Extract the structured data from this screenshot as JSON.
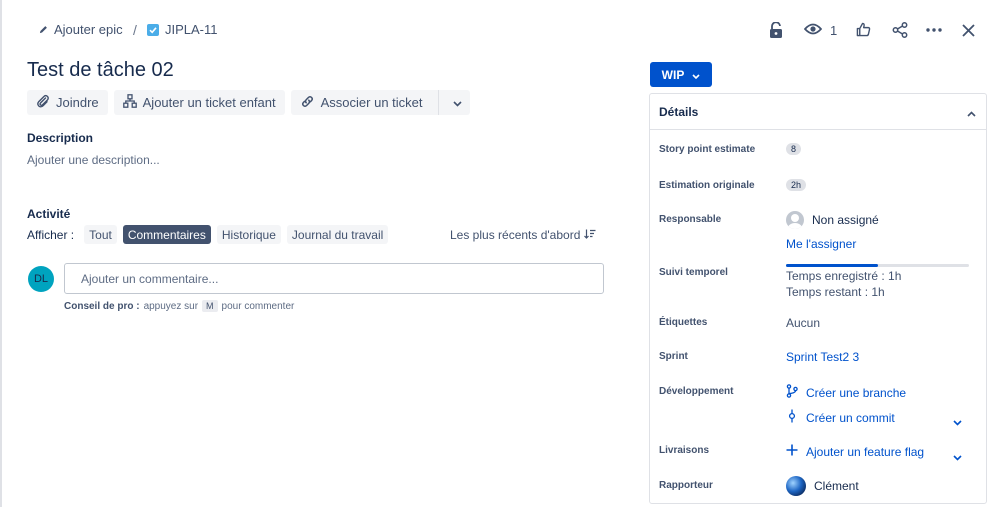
{
  "breadcrumb": {
    "epic_label": "Ajouter epic",
    "separator": "/",
    "issue_key": "JIPLA-11"
  },
  "header": {
    "watchers_count": "1"
  },
  "issue": {
    "title": "Test de tâche 02"
  },
  "actions": {
    "attach": "Joindre",
    "add_child": "Ajouter un ticket enfant",
    "link_issue": "Associer un ticket"
  },
  "description": {
    "label": "Description",
    "placeholder": "Ajouter une description..."
  },
  "activity": {
    "label": "Activité",
    "show_label": "Afficher :",
    "filters": [
      "Tout",
      "Commentaires",
      "Historique",
      "Journal du travail"
    ],
    "active_filter": "Commentaires",
    "sort_label": "Les plus récents d'abord"
  },
  "comment": {
    "avatar_initials": "DL",
    "placeholder": "Ajouter un commentaire...",
    "tip_prefix": "Conseil de pro :",
    "tip_text": "appuyez sur",
    "tip_key": "M",
    "tip_suffix": "pour commenter"
  },
  "status": {
    "label": "WIP"
  },
  "details": {
    "title": "Détails",
    "story_points": {
      "label": "Story point estimate",
      "value": "8"
    },
    "original_estimate": {
      "label": "Estimation originale",
      "value": "2h"
    },
    "assignee": {
      "label": "Responsable",
      "value": "Non assigné",
      "assign_me": "Me l'assigner"
    },
    "time_tracking": {
      "label": "Suivi temporel",
      "logged": "Temps enregistré : 1h",
      "remaining": "Temps restant : 1h",
      "progress": 0.5
    },
    "labels": {
      "label": "Étiquettes",
      "value": "Aucun"
    },
    "sprint": {
      "label": "Sprint",
      "value": "Sprint Test2 3"
    },
    "development": {
      "label": "Développement",
      "create_branch": "Créer une branche",
      "create_commit": "Créer un commit"
    },
    "releases": {
      "label": "Livraisons",
      "add_flag": "Ajouter un feature flag"
    },
    "reporter": {
      "label": "Rapporteur",
      "value": "Clément"
    }
  },
  "colors": {
    "primary": "#0052cc",
    "text": "#172b4d",
    "subtle": "#42526e",
    "avatar_dl": "#00a3bf"
  }
}
